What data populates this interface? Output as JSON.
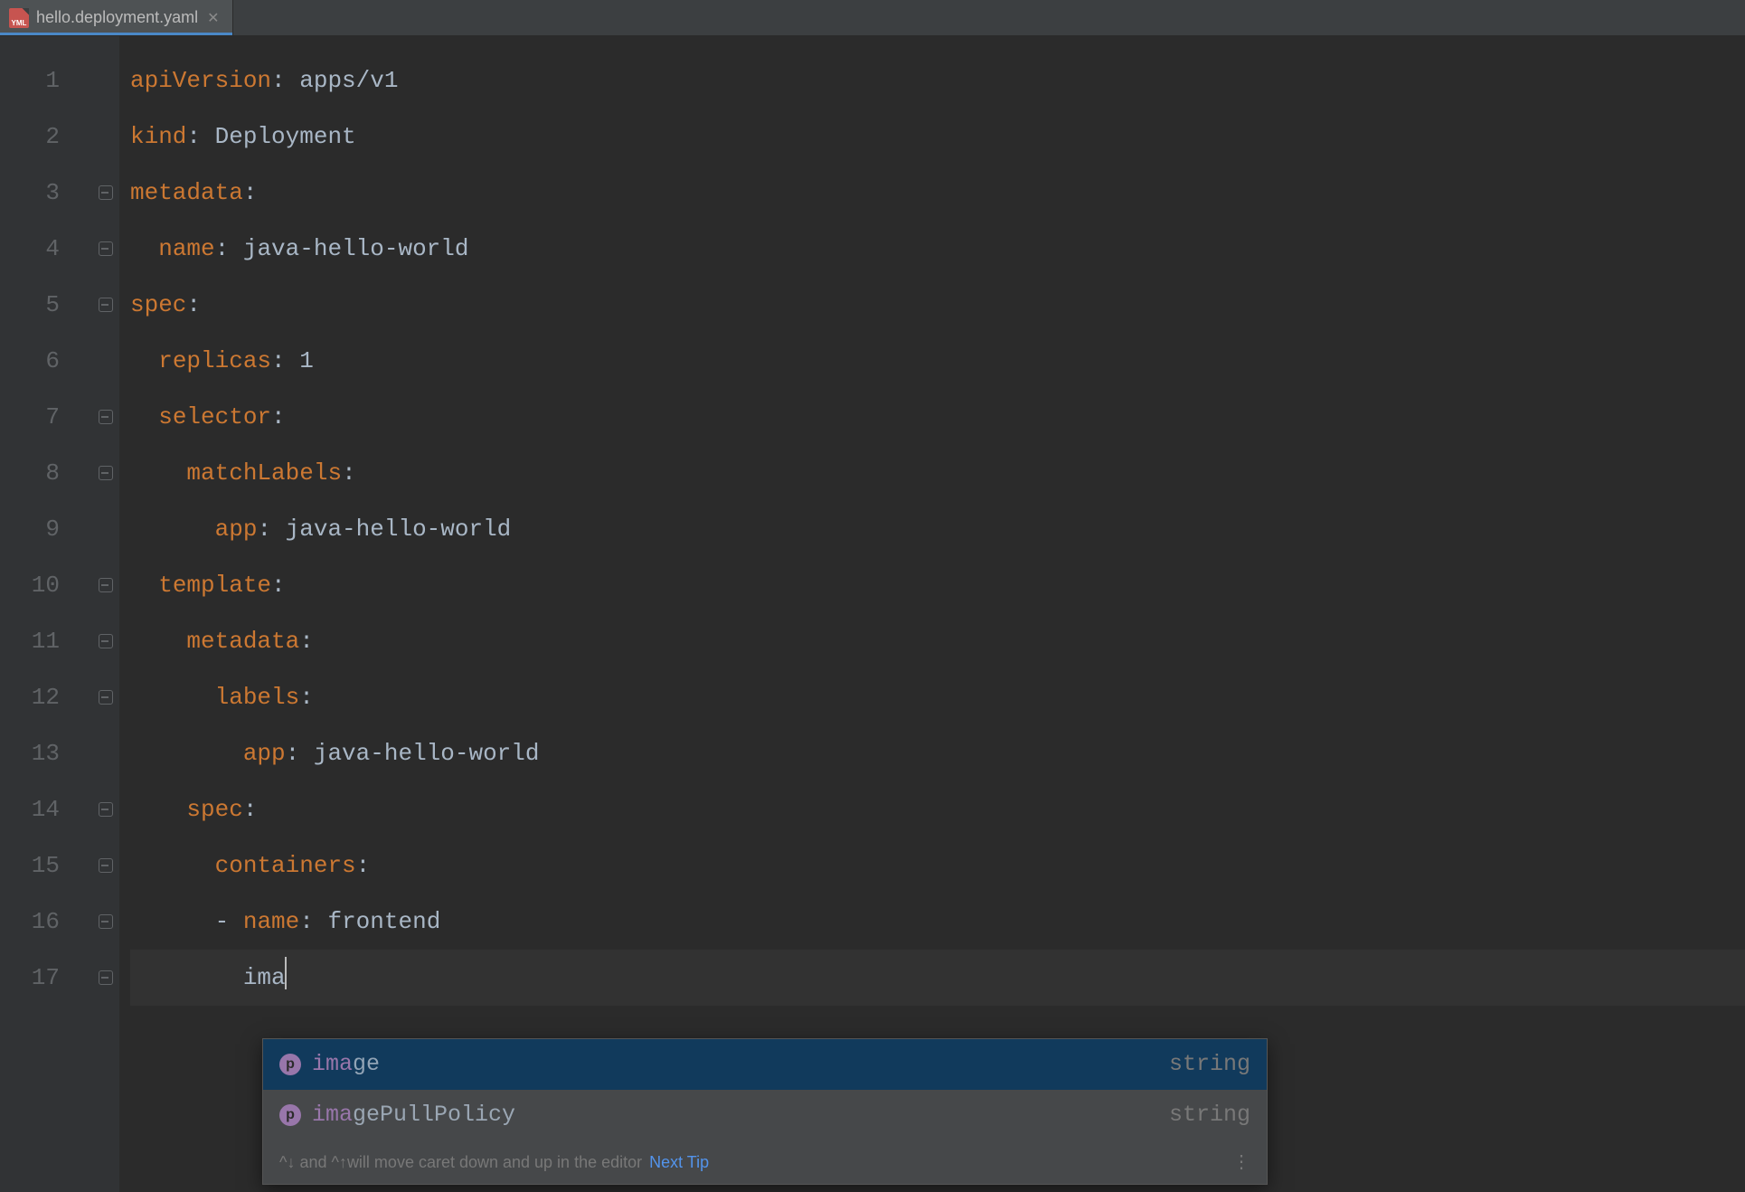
{
  "tab": {
    "filename": "hello.deployment.yaml",
    "icon_label": "YML"
  },
  "gutter": {
    "line_numbers": [
      "1",
      "2",
      "3",
      "4",
      "5",
      "6",
      "7",
      "8",
      "9",
      "10",
      "11",
      "12",
      "13",
      "14",
      "15",
      "16",
      "17"
    ],
    "fold_lines": [
      3,
      4,
      5,
      7,
      8,
      10,
      11,
      12,
      14,
      15,
      16,
      17
    ]
  },
  "code": {
    "lines": [
      {
        "indent": 0,
        "key": "apiVersion",
        "value": "apps/v1"
      },
      {
        "indent": 0,
        "key": "kind",
        "value": "Deployment"
      },
      {
        "indent": 0,
        "key": "metadata",
        "value": ""
      },
      {
        "indent": 1,
        "key": "name",
        "value": "java-hello-world"
      },
      {
        "indent": 0,
        "key": "spec",
        "value": ""
      },
      {
        "indent": 1,
        "key": "replicas",
        "value": "1"
      },
      {
        "indent": 1,
        "key": "selector",
        "value": ""
      },
      {
        "indent": 2,
        "key": "matchLabels",
        "value": ""
      },
      {
        "indent": 3,
        "key": "app",
        "value": "java-hello-world"
      },
      {
        "indent": 1,
        "key": "template",
        "value": ""
      },
      {
        "indent": 2,
        "key": "metadata",
        "value": ""
      },
      {
        "indent": 3,
        "key": "labels",
        "value": ""
      },
      {
        "indent": 4,
        "key": "app",
        "value": "java-hello-world"
      },
      {
        "indent": 2,
        "key": "spec",
        "value": ""
      },
      {
        "indent": 3,
        "key": "containers",
        "value": ""
      },
      {
        "indent": 3,
        "dash": true,
        "key": "name",
        "value": "frontend"
      },
      {
        "indent": 4,
        "typed": "ima",
        "caret": true
      }
    ]
  },
  "completion": {
    "items": [
      {
        "icon": "p",
        "match": "ima",
        "rest": "ge",
        "type": "string",
        "selected": true
      },
      {
        "icon": "p",
        "match": "ima",
        "rest": "gePullPolicy",
        "type": "string",
        "selected": false
      }
    ],
    "hint_keys": "^↓ and ^↑",
    "hint_text": " will move caret down and up in the editor",
    "next_tip": "Next Tip",
    "dots": "⋮"
  }
}
